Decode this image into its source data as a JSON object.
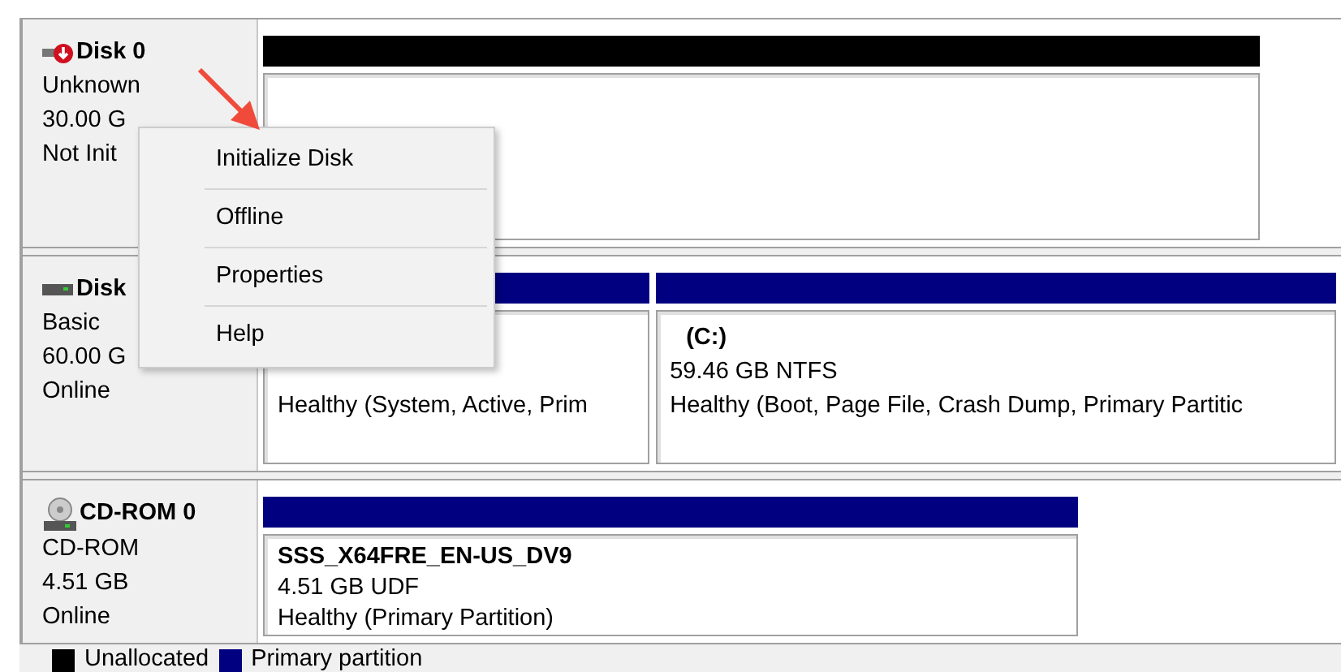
{
  "disks": [
    {
      "name": "Disk 0",
      "kind": "not_initialized",
      "lines": [
        "Unknown",
        "30.00 G",
        "Not Init"
      ],
      "partitions": [
        {
          "kind": "unallocated"
        }
      ]
    },
    {
      "name": "Disk",
      "kind": "basic",
      "lines": [
        "Basic",
        "60.00 G",
        "Online"
      ],
      "partitions": [
        {
          "kind": "primary",
          "status": "Healthy (System, Active, Prim"
        },
        {
          "kind": "primary",
          "label": "(C:)",
          "size": "59.46 GB NTFS",
          "status": "Healthy (Boot, Page File, Crash Dump, Primary Partitic"
        }
      ]
    },
    {
      "name": "CD-ROM 0",
      "kind": "cdrom",
      "lines": [
        "CD-ROM",
        "4.51 GB",
        "Online"
      ],
      "partitions": [
        {
          "kind": "primary",
          "label": "SSS_X64FRE_EN-US_DV9",
          "size": "4.51 GB UDF",
          "status": "Healthy (Primary Partition)"
        }
      ]
    }
  ],
  "context_menu": {
    "items": [
      "Initialize Disk",
      "Offline",
      "Properties",
      "Help"
    ]
  },
  "legend": [
    {
      "label": "Unallocated",
      "kind": "unallocated"
    },
    {
      "label": "Primary partition",
      "kind": "primary"
    }
  ]
}
